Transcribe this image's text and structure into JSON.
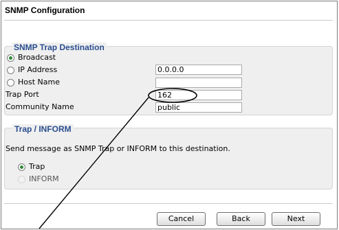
{
  "page": {
    "title": "SNMP Configuration"
  },
  "trap_destination": {
    "legend": "SNMP Trap Destination",
    "options": [
      {
        "label": "Broadcast",
        "checked": true
      },
      {
        "label": "IP Address",
        "checked": false
      },
      {
        "label": "Host Name",
        "checked": false
      }
    ],
    "ip_address_value": "0.0.0.0",
    "host_name_value": "",
    "trap_port_label": "Trap Port",
    "trap_port_value": "162",
    "community_name_label": "Community Name",
    "community_name_value": "public"
  },
  "trap_inform": {
    "legend": "Trap / INFORM",
    "description": "Send message as SNMP Trap or INFORM to this destination.",
    "options": [
      {
        "label": "Trap",
        "checked": true
      },
      {
        "label": "INFORM",
        "checked": false,
        "disabled": true
      }
    ]
  },
  "buttons": {
    "cancel": "Cancel",
    "back": "Back",
    "next": "Next"
  },
  "annotation": {
    "ellipse_color": "#000000",
    "arrow_color": "#000000",
    "target": "Trap Port"
  }
}
